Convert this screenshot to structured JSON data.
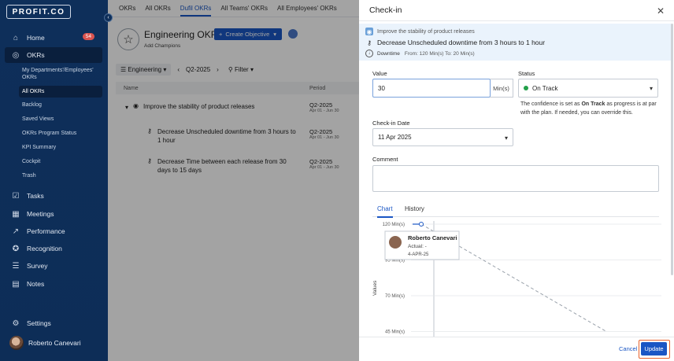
{
  "sidebar": {
    "logo": "PROFIT.CO",
    "items": [
      {
        "label": "Home",
        "icon": "home-icon",
        "badge": "54"
      },
      {
        "label": "OKRs",
        "icon": "target-icon"
      },
      {
        "label": "Tasks",
        "icon": "tasks-icon"
      },
      {
        "label": "Meetings",
        "icon": "calendar-icon"
      },
      {
        "label": "Performance",
        "icon": "chart-icon"
      },
      {
        "label": "Recognition",
        "icon": "award-icon"
      },
      {
        "label": "Survey",
        "icon": "survey-icon"
      },
      {
        "label": "Notes",
        "icon": "notes-icon"
      },
      {
        "label": "Settings",
        "icon": "gear-icon"
      }
    ],
    "okr_sub": [
      "My Departments'/Employees' OKRs",
      "All OKRs",
      "Backlog",
      "Saved Views",
      "OKRs Program Status",
      "KPI Summary",
      "Cockpit",
      "Trash"
    ],
    "user_name": "Roberto Canevari"
  },
  "main": {
    "tabs": [
      "OKRs",
      "All OKRs",
      "Dufil OKRs",
      "All Teams' OKRs",
      "All Employees' OKRs"
    ],
    "title": "Engineering OKRs",
    "create_label": "Create Objective",
    "add_champions": "Add Champions",
    "filter_team": "Engineering",
    "period": "Q2-2025",
    "filter_label": "Filter",
    "col_name": "Name",
    "col_period": "Period",
    "rows": [
      {
        "name": "Improve the stability of product releases",
        "period": "Q2-2025",
        "range": "Apr 01 - Jun 30"
      },
      {
        "name": "Decrease Unscheduled downtime from 3 hours to 1 hour",
        "period": "Q2-2025",
        "range": "Apr 01 - Jun 30"
      },
      {
        "name": "Decrease Time between each release from 30 days to 15 days",
        "period": "Q2-2025",
        "range": "Apr 01 - Jun 30"
      }
    ]
  },
  "drawer": {
    "title": "Check-in",
    "objective": "Improve the stability of product releases",
    "key_result": "Decrease Unscheduled downtime from 3 hours to 1 hour",
    "direction": "Downtime",
    "from_to": "From: 120 Min(s) To: 20 Min(s)",
    "value_label": "Value",
    "value": "30",
    "unit": "Min(s)",
    "status_label": "Status",
    "status": "On Track",
    "status_color": "#23a04a",
    "hint_pre": "The confidence is set as ",
    "hint_bold": "On Track",
    "hint_post": " as progress is at par with the plan. If needed, you can override this.",
    "date_label": "Check-in Date",
    "date": "11 Apr 2025",
    "comment_label": "Comment",
    "tab_chart": "Chart",
    "tab_history": "History",
    "cancel": "Cancel",
    "update": "Update"
  },
  "chart_data": {
    "type": "line",
    "ylabel": "Values",
    "y_ticks": [
      "120 Min(s)",
      "95 Min(s)",
      "70 Min(s)",
      "45 Min(s)"
    ],
    "y_tick_values": [
      120,
      95,
      70,
      45
    ],
    "ylim": [
      45,
      120
    ],
    "series": [
      {
        "values": [
          120,
          45
        ]
      }
    ],
    "tooltip": {
      "name": "Roberto Canevari",
      "actual": "Actual: -",
      "date": "4-APR-25"
    }
  }
}
